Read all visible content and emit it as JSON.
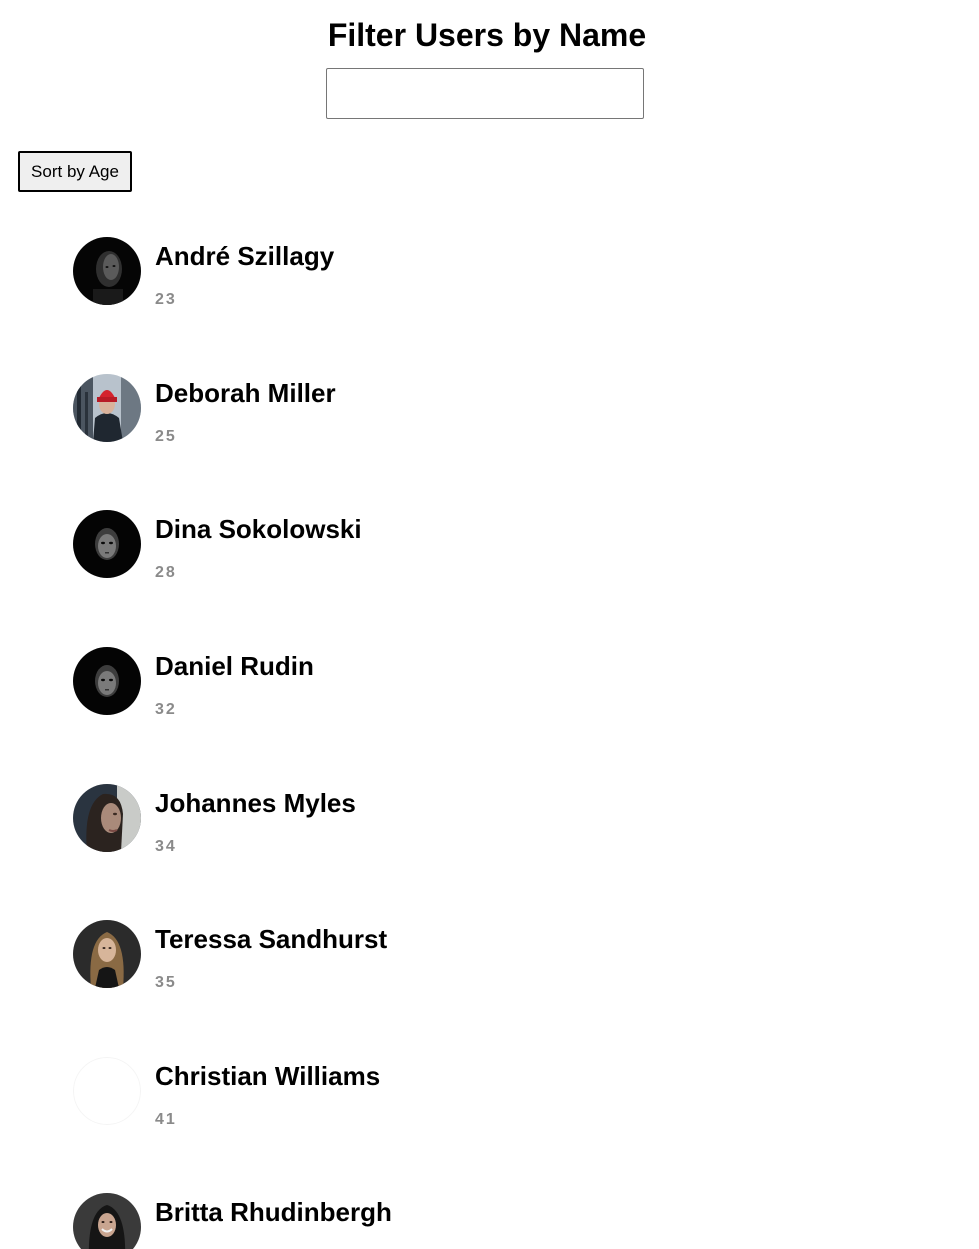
{
  "header": {
    "title": "Filter Users by Name"
  },
  "search": {
    "value": "",
    "placeholder": ""
  },
  "controls": {
    "sort_label": "Sort by Age"
  },
  "users": [
    {
      "name": "André Szillagy",
      "age": "23",
      "avatar": "dark-portrait"
    },
    {
      "name": "Deborah Miller",
      "age": "25",
      "avatar": "red-beanie-portrait"
    },
    {
      "name": "Dina Sokolowski",
      "age": "28",
      "avatar": "dark-face-portrait"
    },
    {
      "name": "Daniel Rudin",
      "age": "32",
      "avatar": "dark-face-portrait"
    },
    {
      "name": "Johannes Myles",
      "age": "34",
      "avatar": "profile-portrait"
    },
    {
      "name": "Teressa Sandhurst",
      "age": "35",
      "avatar": "blonde-portrait"
    },
    {
      "name": "Christian Williams",
      "age": "41",
      "avatar": "blank"
    },
    {
      "name": "Britta Rhudinbergh",
      "age": "",
      "avatar": "smiling-portrait"
    }
  ]
}
